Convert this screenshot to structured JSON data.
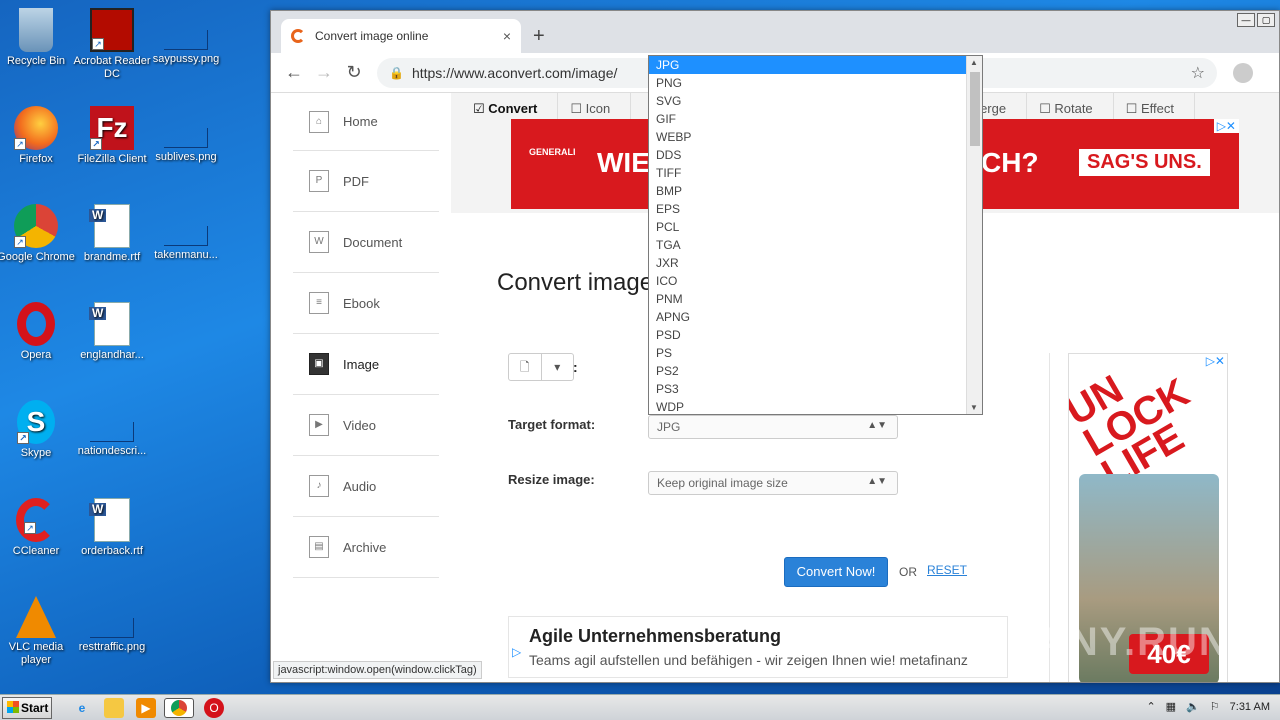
{
  "desktop": {
    "icons": [
      {
        "label": "Recycle Bin",
        "icon": "recycle-bin-icon"
      },
      {
        "label": "Acrobat Reader DC",
        "icon": "acrobat-icon"
      },
      {
        "label": "saypussy.png",
        "icon": "png-file-icon"
      },
      {
        "label": "Firefox",
        "icon": "firefox-icon"
      },
      {
        "label": "FileZilla Client",
        "icon": "filezilla-icon"
      },
      {
        "label": "sublives.png",
        "icon": "png-file-icon"
      },
      {
        "label": "Google Chrome",
        "icon": "chrome-icon"
      },
      {
        "label": "brandme.rtf",
        "icon": "word-doc-icon"
      },
      {
        "label": "takenmanu...",
        "icon": "png-file-icon"
      },
      {
        "label": "Opera",
        "icon": "opera-icon"
      },
      {
        "label": "englandhar...",
        "icon": "word-doc-icon"
      },
      {
        "label": "Skype",
        "icon": "skype-icon"
      },
      {
        "label": "nationdescri...",
        "icon": "png-file-icon"
      },
      {
        "label": "CCleaner",
        "icon": "ccleaner-icon"
      },
      {
        "label": "orderback.rtf",
        "icon": "word-doc-icon"
      },
      {
        "label": "VLC media player",
        "icon": "vlc-icon"
      },
      {
        "label": "resttraffic.png",
        "icon": "png-file-icon"
      }
    ]
  },
  "browser": {
    "tab_title": "Convert image online",
    "tab_close": "×",
    "new_tab": "+",
    "url": "https://www.aconvert.com/image/",
    "status_url": "javascript:window.open(window.clickTag)"
  },
  "sidebar": {
    "items": [
      {
        "label": "Home",
        "glyph": "⌂"
      },
      {
        "label": "PDF",
        "glyph": "P"
      },
      {
        "label": "Document",
        "glyph": "W"
      },
      {
        "label": "Ebook",
        "glyph": "≡"
      },
      {
        "label": "Image",
        "glyph": "▣"
      },
      {
        "label": "Video",
        "glyph": "▶"
      },
      {
        "label": "Audio",
        "glyph": "♪"
      },
      {
        "label": "Archive",
        "glyph": "▤"
      }
    ]
  },
  "subtabs": {
    "convert": "☑ Convert",
    "icon": "☐ Icon",
    "merge": "Merge",
    "rotate": "☐ Rotate",
    "effect": "☐ Effect"
  },
  "ad_banner": {
    "brand": "GENERALI",
    "text_left": "WIE",
    "text_right": "CH?",
    "cta": "SAG'S UNS.",
    "ad_marker": "▷✕"
  },
  "main": {
    "title": "Convert image",
    "file_icon": "🗋",
    "file_caret": "▾",
    "colon": ":",
    "target_label": "Target format:",
    "target_value": "JPG",
    "resize_label": "Resize image:",
    "resize_value": "Keep original image size",
    "select_arrows": "▲▼",
    "convert_button": "Convert Now!",
    "or": "OR",
    "reset": "RESET"
  },
  "format_dropdown": {
    "selected": "JPG",
    "options": [
      "JPG",
      "PNG",
      "SVG",
      "GIF",
      "WEBP",
      "DDS",
      "TIFF",
      "BMP",
      "EPS",
      "PCL",
      "TGA",
      "JXR",
      "ICO",
      "PNM",
      "APNG",
      "PSD",
      "PS",
      "PS2",
      "PS3",
      "WDP"
    ]
  },
  "text_ad": {
    "headline": "Agile Unternehmensberatung",
    "description": "Teams agil aufstellen und befähigen - wir zeigen Ihnen wie! metafinanz",
    "ad_marker": "▷"
  },
  "side_ad": {
    "headline": "UN LOCK LIFE",
    "price": "40€",
    "ad_marker": "▷✕"
  },
  "watermark": "ANY.RUN",
  "taskbar": {
    "start_label": "Start",
    "clock": "7:31 AM"
  }
}
